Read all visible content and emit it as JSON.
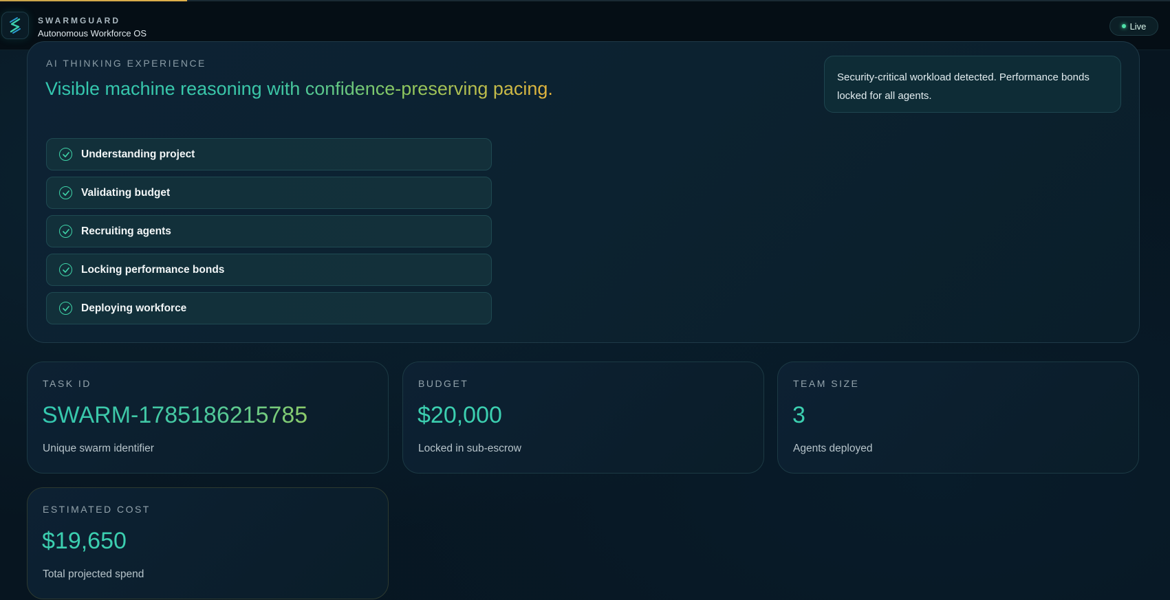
{
  "header": {
    "brand_name": "SWARMGUARD",
    "brand_subtitle": "Autonomous Workforce OS",
    "live_label": "Live",
    "loading_progress": 0.16
  },
  "thinking": {
    "eyebrow": "AI THINKING EXPERIENCE",
    "headline": "Visible machine reasoning with confidence-preserving pacing.",
    "alert": "Security-critical workload detected. Performance bonds locked for all agents.",
    "steps": [
      {
        "label": "Understanding project",
        "status": "complete"
      },
      {
        "label": "Validating budget",
        "status": "complete"
      },
      {
        "label": "Recruiting agents",
        "status": "complete"
      },
      {
        "label": "Locking performance bonds",
        "status": "complete"
      },
      {
        "label": "Deploying workforce",
        "status": "complete"
      }
    ]
  },
  "stats": {
    "task_id": {
      "label": "TASK ID",
      "value": "SWARM-1785186215785",
      "desc": "Unique swarm identifier"
    },
    "budget": {
      "label": "BUDGET",
      "value": "$20,000",
      "desc": "Locked in sub-escrow"
    },
    "team_size": {
      "label": "TEAM SIZE",
      "value": "3",
      "desc": "Agents deployed"
    },
    "estimated_cost": {
      "label": "ESTIMATED COST",
      "value": "$19,650",
      "desc": "Total projected spend"
    }
  },
  "colors": {
    "accent": "#3ccfb0",
    "accent_warm": "#e6b43c",
    "background": "#071520",
    "live_dot": "#4fe0a8"
  }
}
